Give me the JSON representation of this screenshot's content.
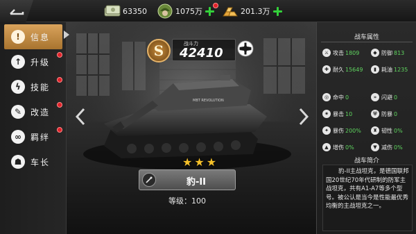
{
  "top_bar": {
    "resources": [
      {
        "name": "cash",
        "value": "63350",
        "icon": "cash-stack-icon"
      },
      {
        "name": "soldier",
        "value": "1075万",
        "icon": "soldier-icon",
        "has_plus": true,
        "has_alert": true
      },
      {
        "name": "gold",
        "value": "201.3万",
        "icon": "gold-bars-icon",
        "has_plus": true
      }
    ]
  },
  "left_menu": {
    "items": [
      {
        "label": "信息",
        "icon": "exclamation-icon",
        "active": true,
        "alert": false
      },
      {
        "label": "升级",
        "icon": "upgrade-arrow-icon",
        "active": false,
        "alert": true
      },
      {
        "label": "技能",
        "icon": "lightning-icon",
        "active": false,
        "alert": true
      },
      {
        "label": "改造",
        "icon": "wrench-icon",
        "active": false,
        "alert": true
      },
      {
        "label": "羁绊",
        "icon": "link-icon",
        "active": false,
        "alert": true
      },
      {
        "label": "车长",
        "icon": "commander-icon",
        "active": false,
        "alert": false
      }
    ]
  },
  "vehicle": {
    "rank": "S",
    "power_label": "战斗力",
    "power": "42410",
    "nation_icon": "iron-cross-icon",
    "stars": 3,
    "name": "豹-II",
    "level_text": "等级：100",
    "hull_text": "MBT REVOLUTION"
  },
  "right_panel": {
    "title": "战车属性",
    "stats": [
      {
        "label": "攻击",
        "value": "1809",
        "icon": "attack-icon"
      },
      {
        "label": "防御",
        "value": "813",
        "icon": "defense-icon"
      },
      {
        "label": "耐久",
        "value": "15649",
        "icon": "durability-icon"
      },
      {
        "label": "耗油",
        "value": "1235",
        "icon": "fuel-icon"
      },
      {
        "label": "命中",
        "value": "0",
        "icon": "hit-icon"
      },
      {
        "label": "闪避",
        "value": "0",
        "icon": "dodge-icon"
      },
      {
        "label": "暴击",
        "value": "10",
        "icon": "crit-icon"
      },
      {
        "label": "防暴",
        "value": "0",
        "icon": "anti-crit-icon"
      },
      {
        "label": "暴伤",
        "value": "200%",
        "icon": "crit-damage-icon"
      },
      {
        "label": "韧性",
        "value": "0%",
        "icon": "toughness-icon"
      },
      {
        "label": "增伤",
        "value": "0%",
        "icon": "damage-boost-icon"
      },
      {
        "label": "减伤",
        "value": "0%",
        "icon": "damage-reduce-icon"
      }
    ],
    "intro_title": "战车简介",
    "intro_text": "豹-II主战坦克，是德国联邦国20世纪70年代研制的防军主战坦克，共有A1-A7等多个型号。被公认是当今是性能最优秀均衡的主战坦克之一。"
  },
  "colors": {
    "accent": "#c9913f",
    "stat_value": "#5fd45f",
    "plus": "#33d13a",
    "alert": "#e0222a"
  }
}
